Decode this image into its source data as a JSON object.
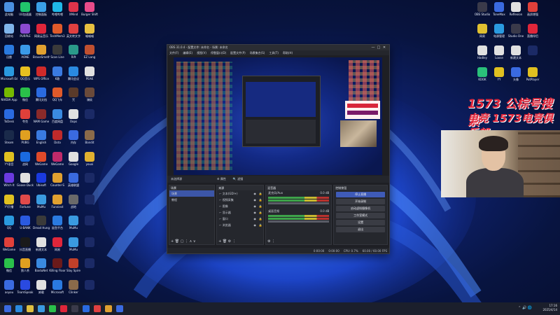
{
  "desktop": {
    "left_icons": [
      {
        "label": "此电脑",
        "color": "#4a8fe0"
      },
      {
        "label": "UU加速器",
        "color": "#21c36b"
      },
      {
        "label": "控制面板",
        "color": "#3aa0e8"
      },
      {
        "label": "哔哩哔哩",
        "color": "#1fb8e8"
      },
      {
        "label": "XMind",
        "color": "#e0334a"
      },
      {
        "label": "Burger Shift",
        "color": "#e84b8a"
      },
      {
        "label": "回收站",
        "color": "#7fb4ea"
      },
      {
        "label": "PURPLE",
        "color": "#8a4ad0"
      },
      {
        "label": "网易云音乐",
        "color": "#e0263a"
      },
      {
        "label": "TeshMem3",
        "color": "#e05a2a"
      },
      {
        "label": "英文转文字",
        "color": "#e04040"
      },
      {
        "label": "喵喵喵",
        "color": "#e8c040"
      },
      {
        "label": "迅雷",
        "color": "#2a7ae0"
      },
      {
        "label": "AONE",
        "color": "#3a9ae8"
      },
      {
        "label": "BraveSmeth",
        "color": "#e0a030"
      },
      {
        "label": "Scan Line",
        "color": "#3a3a3a"
      },
      {
        "label": "Rift",
        "color": "#2a9a8a"
      },
      {
        "label": "EZ Lang",
        "color": "#c05030"
      },
      {
        "label": "Microsoft Edge",
        "color": "#2a9ae0"
      },
      {
        "label": "QQ音乐",
        "color": "#e8c020"
      },
      {
        "label": "WPS Office",
        "color": "#d02a2a"
      },
      {
        "label": "K歌",
        "color": "#3a7ae0"
      },
      {
        "label": "腾讯会议",
        "color": "#2a8ae0"
      },
      {
        "label": "PEAK",
        "color": "#e0e0e0"
      },
      {
        "label": "NVIDIA App",
        "color": "#76b900"
      },
      {
        "label": "微信",
        "color": "#2ac04a"
      },
      {
        "label": "腾讯文档",
        "color": "#2a6ae0"
      },
      {
        "label": "QQ飞车",
        "color": "#e05a2a"
      },
      {
        "label": "咒",
        "color": "#5a3a2a"
      },
      {
        "label": "骑砍",
        "color": "#6a4a3a"
      },
      {
        "label": "ToDesk",
        "color": "#2a6ae0"
      },
      {
        "label": "夸克",
        "color": "#e0403a"
      },
      {
        "label": "NAM Game",
        "color": "#8a2a2a"
      },
      {
        "label": "百度网盘",
        "color": "#3a8ae0"
      },
      {
        "label": "Oops",
        "color": "#e0e0e0"
      },
      {
        "label": "",
        "color": "#1b2a66"
      },
      {
        "label": "Steam",
        "color": "#1a2a4a"
      },
      {
        "label": "PUBG",
        "color": "#e0a020"
      },
      {
        "label": "English",
        "color": "#3a7ae0"
      },
      {
        "label": "Dota",
        "color": "#c02a2a"
      },
      {
        "label": "内存",
        "color": "#3a6ae0"
      },
      {
        "label": "Bandit",
        "color": "#8a6a4a"
      },
      {
        "label": "YY语音",
        "color": "#e0c020"
      },
      {
        "label": "战网",
        "color": "#1a6ae0"
      },
      {
        "label": "WeGame",
        "color": "#e04a2a"
      },
      {
        "label": "WeGame",
        "color": "#c02a6a"
      },
      {
        "label": "Google",
        "color": "#e0e0e0"
      },
      {
        "label": "youxi",
        "color": "#e0b030"
      },
      {
        "label": "Witch It",
        "color": "#6a3ae0"
      },
      {
        "label": "Goose Duck",
        "color": "#e0e0e0"
      },
      {
        "label": "Ubisoft",
        "color": "#1a3ae0"
      },
      {
        "label": "Counter-S",
        "color": "#e0a030"
      },
      {
        "label": "英雄联盟",
        "color": "#3a6ae0"
      },
      {
        "label": "",
        "color": "#1b2a66"
      },
      {
        "label": "YY开播",
        "color": "#e0c020"
      },
      {
        "label": "Fortune",
        "color": "#e04a4a"
      },
      {
        "label": "MuMu",
        "color": "#3a9ae0"
      },
      {
        "label": "Funniest",
        "color": "#e0a030"
      },
      {
        "label": "战地",
        "color": "#6a6a6a"
      },
      {
        "label": "",
        "color": "#1b2a66"
      },
      {
        "label": "QQ",
        "color": "#2a9ae0"
      },
      {
        "label": "U-BANK",
        "color": "#2a5ae0"
      },
      {
        "label": "Dread Hunger",
        "color": "#3a3a3a"
      },
      {
        "label": "鲨鱼平台",
        "color": "#2a7ae0"
      },
      {
        "label": "MuMu",
        "color": "#3a9ae0"
      },
      {
        "label": "",
        "color": "#1b2a66"
      },
      {
        "label": "WeGame",
        "color": "#e0403a"
      },
      {
        "label": "抖音直播",
        "color": "#1a1a1a"
      },
      {
        "label": "新建文本",
        "color": "#e0e0e0"
      },
      {
        "label": "网易",
        "color": "#e0263a"
      },
      {
        "label": "MuMu",
        "color": "#3a9ae0"
      },
      {
        "label": "",
        "color": "#1b2a66"
      },
      {
        "label": "微信",
        "color": "#2ac04a"
      },
      {
        "label": "狼人杀",
        "color": "#e0a020"
      },
      {
        "label": "BaiduNet",
        "color": "#3a8ae0"
      },
      {
        "label": "Killing Floor",
        "color": "#6a1a1a"
      },
      {
        "label": "Slay Spire",
        "color": "#c0402a"
      },
      {
        "label": "",
        "color": "#1b2a66"
      },
      {
        "label": "aoyou",
        "color": "#3a6ae0"
      },
      {
        "label": "TeamSpeak",
        "color": "#2a4ae0"
      },
      {
        "label": "卸载",
        "color": "#e0e0e0"
      },
      {
        "label": "Microsoft",
        "color": "#2a7ae0"
      },
      {
        "label": "Clinker",
        "color": "#8a6a4a"
      },
      {
        "label": "",
        "color": "#1b2a66"
      }
    ],
    "right_icons": [
      {
        "label": "OBS Studio",
        "color": "#3a3a4a"
      },
      {
        "label": "ToneMax",
        "color": "#3a6ae0"
      },
      {
        "label": "Reflexion",
        "color": "#e0e0e0"
      },
      {
        "label": "画质增强",
        "color": "#e0403a"
      },
      {
        "label": "网易",
        "color": "#e0c030"
      },
      {
        "label": "电源管理",
        "color": "#2a9ae0"
      },
      {
        "label": "Studio One",
        "color": "#3a3a4a"
      },
      {
        "label": "直播伴侣",
        "color": "#e0263a"
      },
      {
        "label": "Hadley",
        "color": "#e0e0e0"
      },
      {
        "label": "Loose",
        "color": "#e0e0e0"
      },
      {
        "label": "新建文本",
        "color": "#e0e0e0"
      },
      {
        "label": "",
        "color": "#1b2a66"
      },
      {
        "label": "KOOK",
        "color": "#2ac07a"
      },
      {
        "label": "YY",
        "color": "#e0c020"
      },
      {
        "label": "头像",
        "color": "#3a6ae0"
      },
      {
        "label": "PotPlayer",
        "color": "#e0c020"
      }
    ]
  },
  "obs": {
    "title": "OBS 31.0.4 - 配置文件: 未命名 - 场景: 未命名",
    "win_buttons": [
      "—",
      "□",
      "✕"
    ],
    "menu": [
      "文件(F)",
      "编辑(E)",
      "视图(V)",
      "停靠窗口(D)",
      "配置文件(P)",
      "场景集合(S)",
      "工具(T)",
      "帮助(H)"
    ],
    "status_chips": [
      "未选择源",
      "⚙ 属性",
      "🔍 滤镜"
    ],
    "scenes": {
      "header": "场景",
      "items": [
        "场景",
        "教程"
      ]
    },
    "sources": {
      "header": "来源",
      "items": [
        "⌐ 文本(GDI+)",
        "⌐ 视频采集",
        "⌐ 图像",
        "⌐ 显示器",
        "⌐ 窗口",
        "⌐ 浏览器"
      ]
    },
    "mixer": {
      "header": "混音器",
      "channels": [
        {
          "name": "麦克风/Aux",
          "db": "0.0 dB"
        },
        {
          "name": "桌面音频",
          "db": "0.0 dB"
        }
      ]
    },
    "controls": {
      "header": "控制按钮",
      "buttons": [
        "停止直播",
        "开始录制",
        "启动虚拟摄像机",
        "工作室模式",
        "设置",
        "退出"
      ]
    },
    "footer": [
      "0:00:00",
      "0:00:00",
      "CPU: 0.7%",
      "60.00 / 60.00 FPS"
    ]
  },
  "banner": {
    "line1": "1573 公棕号搜索",
    "line2": "电竞 1573电竞俱乐部"
  },
  "taskbar": {
    "icons": [
      "#2a8ae0",
      "#e0c040",
      "#3a9ae0",
      "#2ac04a",
      "#e0263a",
      "#3a3a4a",
      "#2a6ae0",
      "#e04040",
      "#e0a030",
      "#3a6ae0"
    ],
    "time": "17:16",
    "date": "2025/4/14"
  }
}
